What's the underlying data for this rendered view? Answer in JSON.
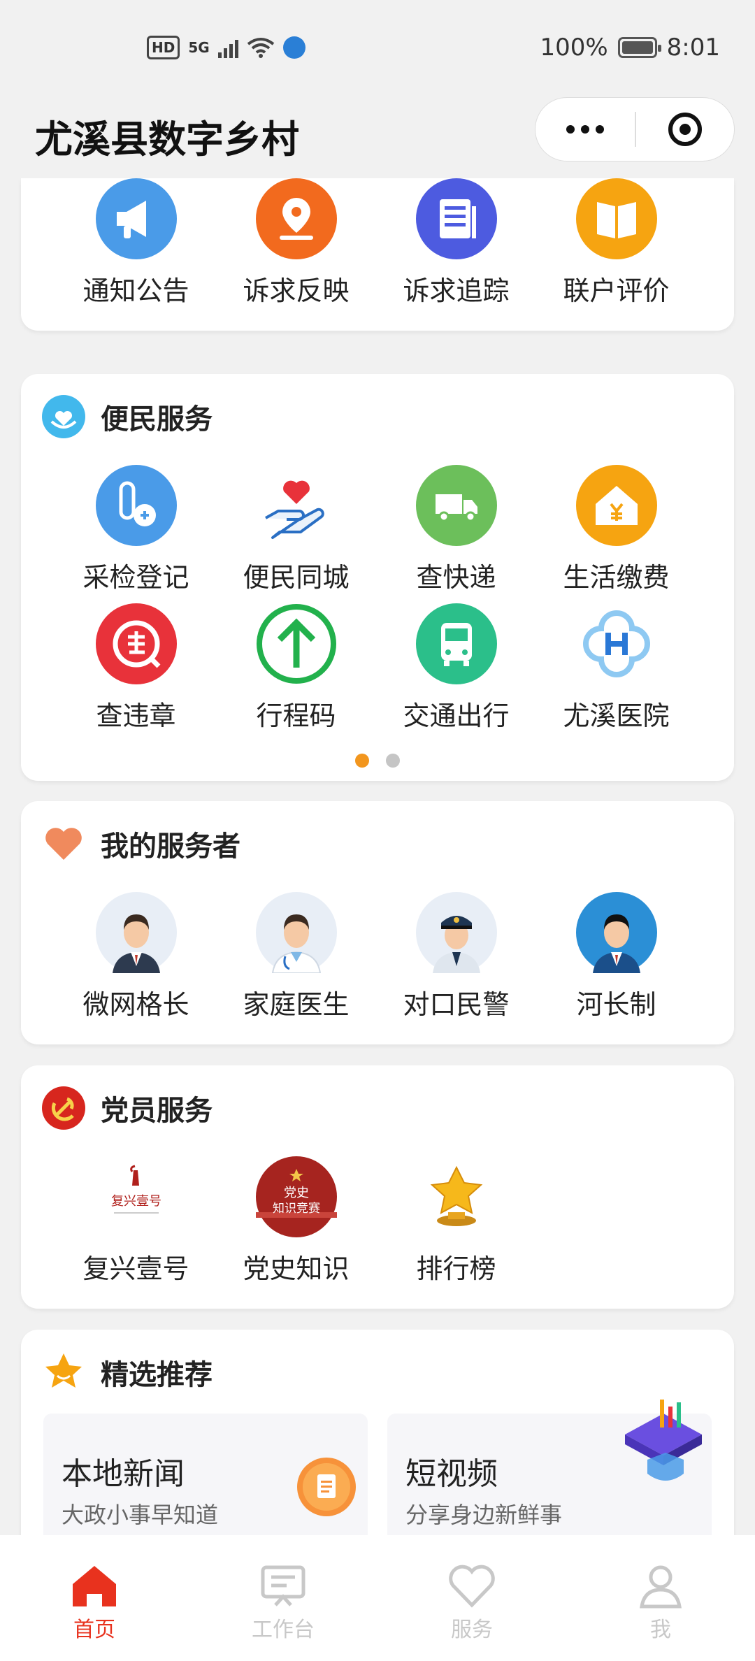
{
  "status_bar": {
    "hd": "HD",
    "network": "5G",
    "battery": "100%",
    "time": "8:01"
  },
  "header": {
    "title": "尤溪县数字乡村"
  },
  "top_services": [
    {
      "label": "通知公告",
      "icon": "megaphone-icon",
      "color": "#4a9be8"
    },
    {
      "label": "诉求反映",
      "icon": "location-pin-icon",
      "color": "#f26a1e"
    },
    {
      "label": "诉求追踪",
      "icon": "document-icon",
      "color": "#4d5be0"
    },
    {
      "label": "联户评价",
      "icon": "book-icon",
      "color": "#f6a411"
    }
  ],
  "convenience": {
    "title": "便民服务",
    "items": [
      {
        "label": "采检登记",
        "icon": "test-tube-icon",
        "color": "#4a9be8"
      },
      {
        "label": "便民同城",
        "icon": "heart-hand-icon",
        "color": "#e8323a"
      },
      {
        "label": "查快递",
        "icon": "truck-icon",
        "color": "#6cbf5b"
      },
      {
        "label": "生活缴费",
        "icon": "house-yen-icon",
        "color": "#f6a411"
      },
      {
        "label": "查违章",
        "icon": "violation-icon",
        "color": "#e8323a"
      },
      {
        "label": "行程码",
        "icon": "arrow-up-icon",
        "color": "#22b14c"
      },
      {
        "label": "交通出行",
        "icon": "bus-icon",
        "color": "#2bbf8a"
      },
      {
        "label": "尤溪医院",
        "icon": "hospital-logo-icon",
        "color": "#3d8fe0"
      }
    ],
    "pager": {
      "active_color": "#f2961e",
      "inactive_color": "#c5c5c5"
    }
  },
  "servers": {
    "title": "我的服务者",
    "items": [
      {
        "label": "微网格长",
        "icon": "grid-leader-avatar-icon"
      },
      {
        "label": "家庭医生",
        "icon": "doctor-avatar-icon"
      },
      {
        "label": "对口民警",
        "icon": "police-avatar-icon"
      },
      {
        "label": "河长制",
        "icon": "river-chief-avatar-icon"
      }
    ]
  },
  "party": {
    "title": "党员服务",
    "items": [
      {
        "label": "复兴壹号",
        "icon": "fuxing-logo-icon",
        "logo_text": "复兴壹号"
      },
      {
        "label": "党史知识",
        "icon": "party-history-icon",
        "logo_text": "党史知识竞赛"
      },
      {
        "label": "排行榜",
        "icon": "trophy-star-icon"
      }
    ]
  },
  "recommend": {
    "title": "精选推荐",
    "items": [
      {
        "title": "本地新闻",
        "subtitle": "大政小事早知道",
        "icon": "news-icon"
      },
      {
        "title": "短视频",
        "subtitle": "分享身边新鲜事",
        "icon": "video-3d-icon"
      }
    ]
  },
  "tabbar": [
    {
      "label": "首页",
      "icon": "home-icon",
      "active": true
    },
    {
      "label": "工作台",
      "icon": "workbench-icon",
      "active": false
    },
    {
      "label": "服务",
      "icon": "heart-outline-icon",
      "active": false
    },
    {
      "label": "我",
      "icon": "user-icon",
      "active": false
    }
  ],
  "colors": {
    "active_tab": "#e8321e",
    "inactive_tab": "#c8c8c8"
  }
}
